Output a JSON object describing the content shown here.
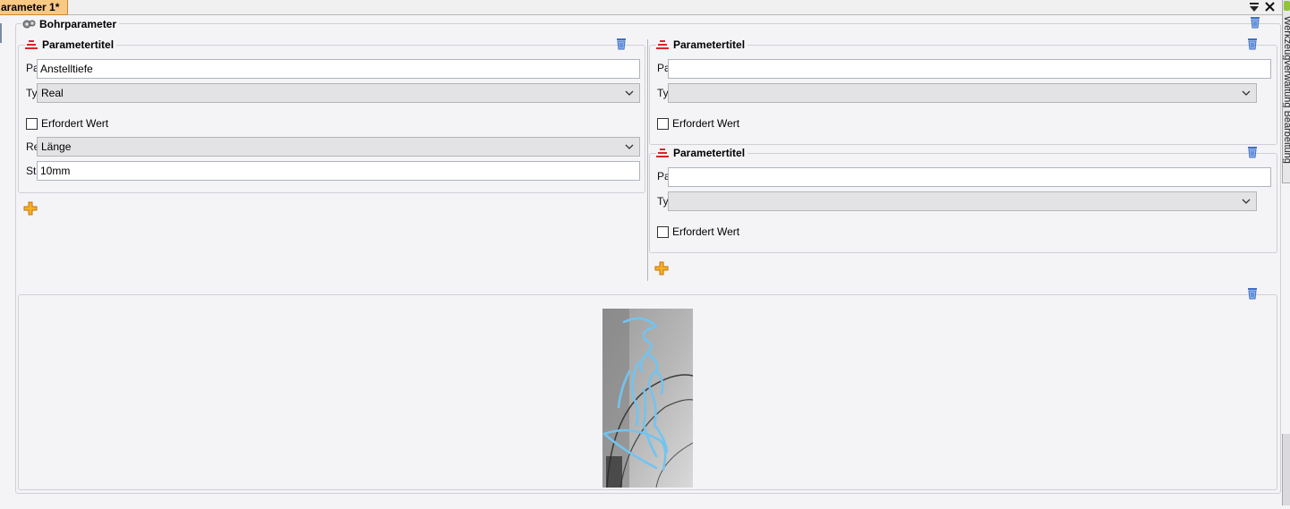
{
  "window": {
    "tab_title": "arameter 1*",
    "side_tab_text": "Werkzeugverwaltung Bearbeitung"
  },
  "outer_group": {
    "title": "Bohrparameter"
  },
  "left_param": {
    "title": "Parametertitel",
    "name_label": "Pa",
    "name_value": "Anstelltiefe",
    "type_label": "Typ",
    "type_value": "Real",
    "required_label": "Erfordert Wert",
    "ref_label": "Re",
    "ref_value": "Länge",
    "std_label": "Sta",
    "std_value": "10mm"
  },
  "right_param_1": {
    "title": "Parametertitel",
    "name_label": "Pa",
    "name_value": "",
    "type_label": "Typ",
    "type_value": "",
    "required_label": "Erfordert Wert"
  },
  "right_param_2": {
    "title": "Parametertitel",
    "name_label": "Pa",
    "name_value": "",
    "type_label": "Typ",
    "type_value": "",
    "required_label": "Erfordert Wert"
  },
  "colors": {
    "tab_accent": "#f9c883",
    "param_icon": "#d9262b",
    "plus_icon": "#f0a020",
    "trash_icon": "#4d7fd6",
    "drawing_stroke": "#72c4ef"
  },
  "icons": [
    "gear-icon",
    "parameter-icon",
    "trash-icon",
    "plus-icon",
    "chevron-down-icon",
    "close-icon",
    "menu-down-icon"
  ]
}
